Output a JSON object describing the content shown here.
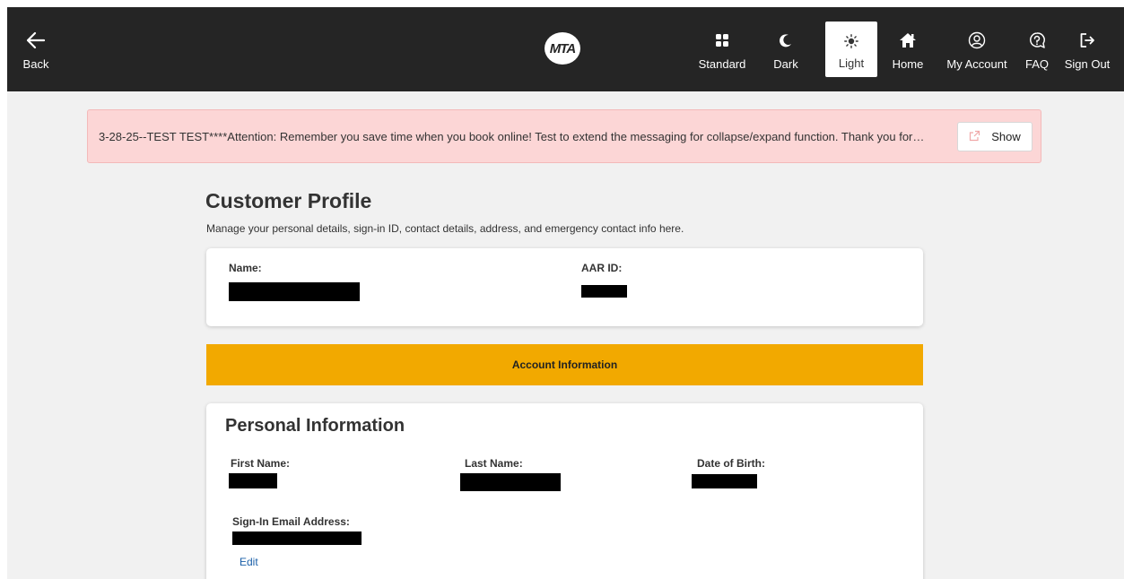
{
  "nav": {
    "back": "Back",
    "standard": "Standard",
    "dark": "Dark",
    "light": "Light",
    "home": "Home",
    "my_account": "My Account",
    "faq": "FAQ",
    "sign_out": "Sign Out",
    "logo_text": "MTA"
  },
  "alert": {
    "message": "3-28-25--TEST TEST****Attention: Remember you save time when you book online! Test to extend the messaging for collapse/expand function. Thank you for…",
    "show_label": "Show"
  },
  "page": {
    "title": "Customer Profile",
    "subtitle": "Manage your personal details, sign-in ID, contact details, address, and emergency contact info here."
  },
  "summary": {
    "name_label": "Name:",
    "aar_label": "AAR ID:"
  },
  "banner": {
    "label": "Account Information"
  },
  "personal": {
    "title": "Personal Information",
    "first_name_label": "First Name:",
    "last_name_label": "Last Name:",
    "dob_label": "Date of Birth:",
    "email_label": "Sign-In Email Address:",
    "edit_label": "Edit"
  },
  "colors": {
    "topbar": "#252525",
    "alert_bg": "#fcd6d6",
    "banner": "#f2a900",
    "link": "#1a5fa8"
  }
}
